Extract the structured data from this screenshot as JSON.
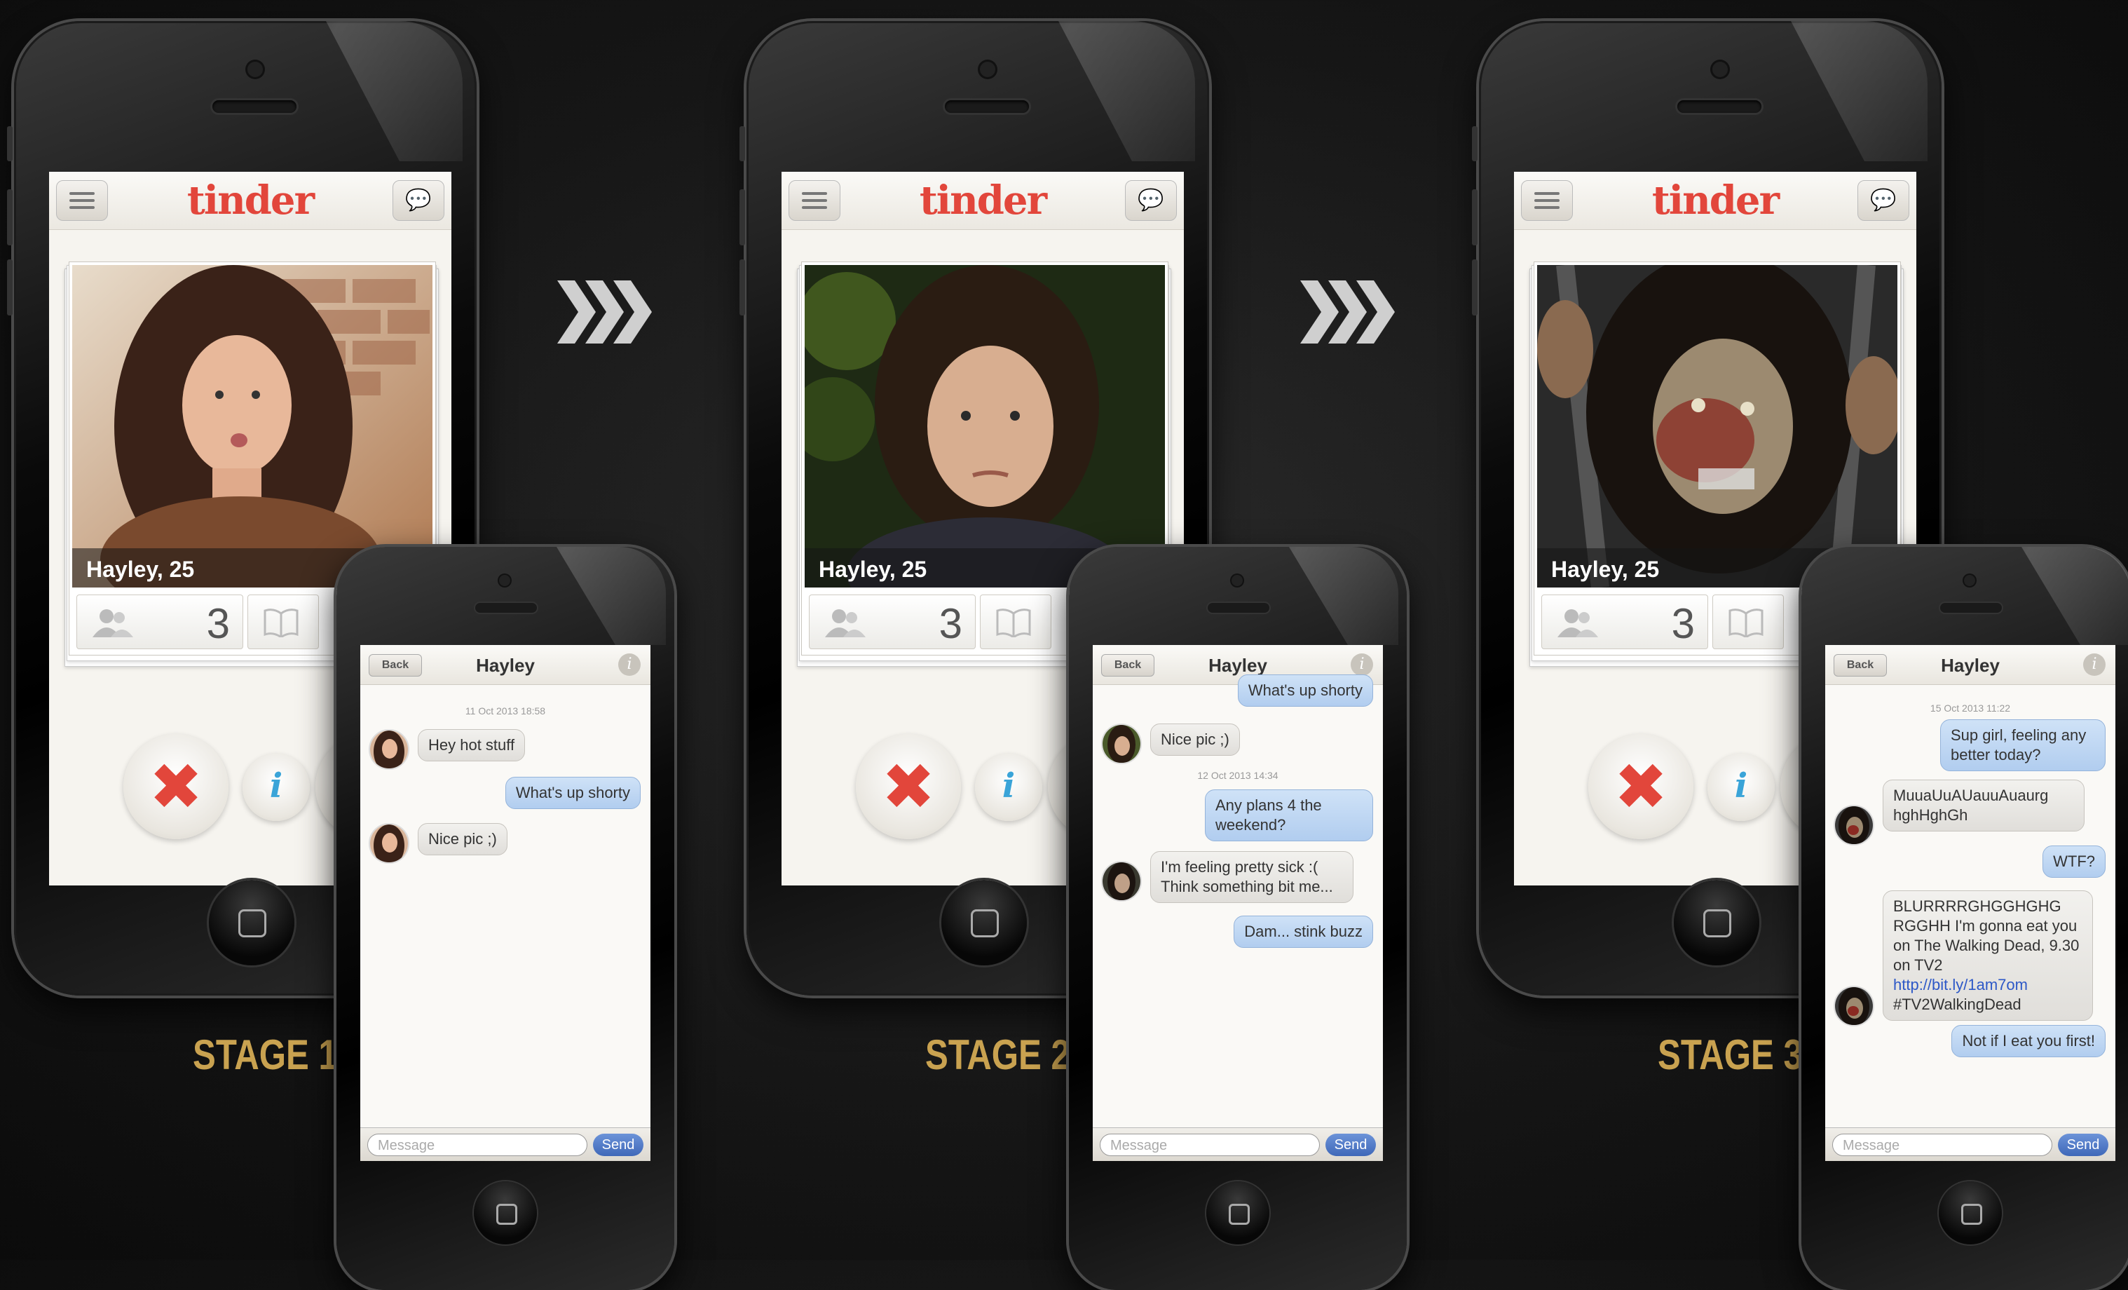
{
  "brand": {
    "logo": "tinder",
    "accent": "#e2463b",
    "like_color": "#5cc55a",
    "info_color": "#3aa4d8",
    "label_color": "#c9a250"
  },
  "stages": [
    {
      "label": "STAGE 1",
      "profile": {
        "name": "Hayley, 25",
        "friends_count": "3"
      },
      "chat": {
        "back": "Back",
        "title": "Hayley",
        "input_placeholder": "Message",
        "send": "Send",
        "timestamps": [
          "11 Oct 2013 18:58"
        ],
        "messages": [
          {
            "from": "them",
            "text": "Hey hot stuff"
          },
          {
            "from": "me",
            "text": "What's up shorty"
          },
          {
            "from": "them",
            "text": "Nice pic ;)"
          }
        ]
      }
    },
    {
      "label": "STAGE 2",
      "profile": {
        "name": "Hayley, 25",
        "friends_count": "3"
      },
      "chat": {
        "back": "Back",
        "title": "Hayley",
        "input_placeholder": "Message",
        "send": "Send",
        "timestamps": [
          "12 Oct 2013 14:34"
        ],
        "messages": [
          {
            "from": "me",
            "text": "What's up shorty"
          },
          {
            "from": "them",
            "text": "Nice pic ;)"
          },
          {
            "from": "me",
            "text": "Any plans 4 the weekend?"
          },
          {
            "from": "them",
            "text": "I'm feeling pretty sick :( Think something bit me..."
          },
          {
            "from": "me",
            "text": "Dam... stink buzz"
          }
        ]
      }
    },
    {
      "label": "STAGE 3",
      "profile": {
        "name": "Hayley, 25",
        "friends_count": "3"
      },
      "chat": {
        "back": "Back",
        "title": "Hayley",
        "input_placeholder": "Message",
        "send": "Send",
        "timestamps": [
          "15 Oct 2013 11:22"
        ],
        "messages": [
          {
            "from": "me",
            "text": "Sup girl, feeling any better today?"
          },
          {
            "from": "them",
            "text": "MuuaUuAUauuAuaurg hghHghGh"
          },
          {
            "from": "me",
            "text": "WTF?"
          },
          {
            "from": "them",
            "text": "BLURRRRGHGGHGHG RGGHH I'm gonna eat you on The Walking Dead, 9.30 on TV2",
            "link": "http://bit.ly/1am7om",
            "tag": "#TV2WalkingDead"
          },
          {
            "from": "me",
            "text": "Not if I eat you first!"
          }
        ]
      }
    }
  ]
}
